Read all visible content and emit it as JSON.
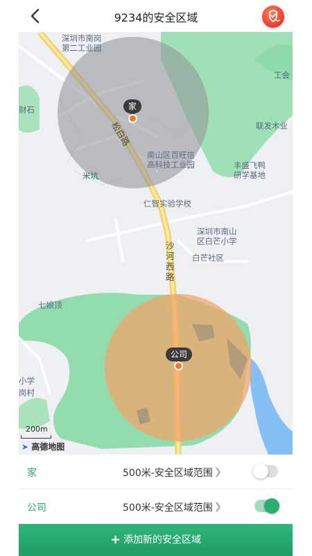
{
  "header": {
    "title": "9234的安全区域",
    "back_icon": "chevron-left-icon",
    "action_icon": "guard-shield-icon",
    "action_color": "#ea3b2c"
  },
  "map": {
    "labels": {
      "industrial_park_2": "深圳市南岗\n第二工业园",
      "labor_union": "工会",
      "caishi": "财石",
      "lianfa": "联发木业",
      "baiwangxin": "南山区百旺信\n高科技工业园",
      "fengsheng": "丰盛飞鸭\n研学基地",
      "mikeng": "米坑",
      "renzhi": "仁智实验学校",
      "baimang_school": "深圳市南山\n区白芒小学",
      "baimang_community": "白芒社区",
      "qiniangding": "七娘顶",
      "left_school": "小学",
      "left_village": "岗村",
      "songbai_road": "松白路",
      "shahe_road": "沙河西路"
    },
    "markers": {
      "home": "家",
      "company": "公司"
    },
    "scale": "200m",
    "provider": "高德地图",
    "colors": {
      "home_zone": "#8f9096",
      "company_zone": "#f3a36a",
      "marker": "#f07a1d",
      "park": "#8fd9ab"
    }
  },
  "zones": [
    {
      "name": "家",
      "range": "500米-安全区域范围",
      "enabled": false
    },
    {
      "name": "公司",
      "range": "500米-安全区域范围",
      "enabled": true
    }
  ],
  "add_button": {
    "label": "添加新的安全区域",
    "icon": "plus-icon"
  },
  "accent_color": "#26a86d"
}
